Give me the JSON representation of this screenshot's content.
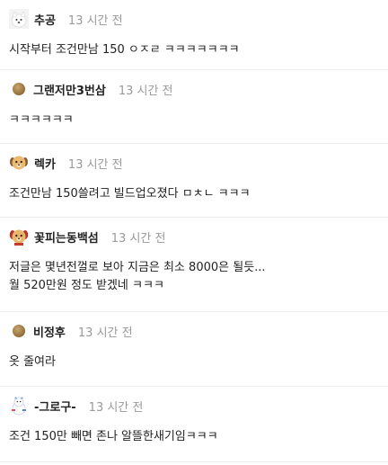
{
  "comments": [
    {
      "nickname": "추공",
      "time": "13 시간 전",
      "avatar": "white-dog-icon",
      "lines": [
        "시작부터 조건만남 150 ㅇㅈㄹ ㅋㅋㅋㅋㅋㅋㅋ"
      ]
    },
    {
      "nickname": "그랜저만3번삼",
      "time": "13 시간 전",
      "avatar": "brown-dot-icon",
      "lines": [
        "ㅋㅋㅋㅋㅋㅋ"
      ]
    },
    {
      "nickname": "렉카",
      "time": "13 시간 전",
      "avatar": "puppy-icon",
      "lines": [
        "조건만남 150쓸려고 빌드업오졌다 ㅁㅊㄴ ㅋㅋㅋ"
      ]
    },
    {
      "nickname": "꽃피는동백섬",
      "time": "13 시간 전",
      "avatar": "puppy-red-icon",
      "lines": [
        "저글은 몇년전껄로 보아 지금은 최소 8000은 될듯...",
        "월 520만원 정도 받겠네 ㅋㅋㅋ"
      ]
    },
    {
      "nickname": "비정후",
      "time": "13 시간 전",
      "avatar": "brown-dot-icon",
      "lines": [
        "옷 줄여라"
      ]
    },
    {
      "nickname": "-그로구-",
      "time": "13 시간 전",
      "avatar": "snow-character-icon",
      "lines": [
        "조건 150만 빼면 존나 알뜰한새기임ㅋㅋㅋ"
      ]
    }
  ]
}
